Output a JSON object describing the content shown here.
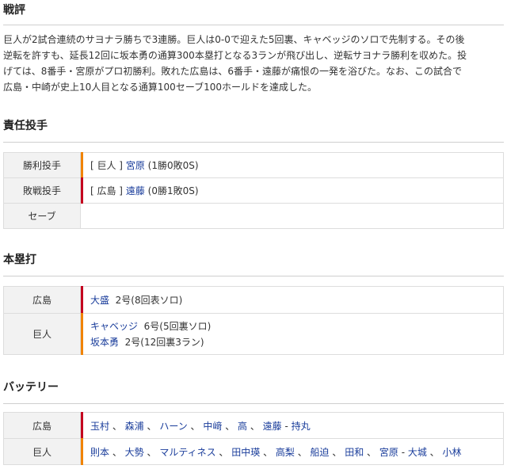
{
  "sections": {
    "review_title": "戦評",
    "pitchers_title": "責任投手",
    "homeruns_title": "本塁打",
    "battery_title": "バッテリー"
  },
  "review": {
    "line1": "巨人が2試合連続のサヨナラ勝ちで3連勝。巨人は0-0で迎えた5回裏、キャベッジのソロで先制する。その後",
    "line2": "逆転を許すも、延長12回に坂本勇の通算300本塁打となる3ランが飛び出し、逆転サヨナラ勝利を収めた。投",
    "line3": "げては、8番手・宮原がプロ初勝利。敗れた広島は、6番手・遠藤が痛恨の一発を浴びた。なお、この試合で",
    "line4": "広島・中崎が史上10人目となる通算100セーブ100ホールドを達成した。"
  },
  "pitchers": {
    "win_label": "勝利投手",
    "win_team": "[ 巨人 ]",
    "win_name": "宮原",
    "win_record": "(1勝0敗0S)",
    "loss_label": "敗戦投手",
    "loss_team": "[ 広島 ]",
    "loss_name": "遠藤",
    "loss_record": "(0勝1敗0S)",
    "save_label": "セーブ"
  },
  "homeruns": {
    "hiroshima_label": "広島",
    "hiroshima": [
      {
        "name": "大盛",
        "detail": "2号(8回表ソロ)"
      }
    ],
    "giants_label": "巨人",
    "giants": [
      {
        "name": "キャベッジ",
        "detail": "6号(5回裏ソロ)"
      },
      {
        "name": "坂本勇",
        "detail": "2号(12回裏3ラン)"
      }
    ]
  },
  "battery": {
    "hiroshima_label": "広島",
    "hiroshima_pitchers": [
      "玉村",
      "森浦",
      "ハーン",
      "中﨑",
      "高",
      "遠藤"
    ],
    "hiroshima_catcher": "持丸",
    "giants_label": "巨人",
    "giants_pitchers": [
      "則本",
      "大勢",
      "マルティネス",
      "田中瑛",
      "高梨",
      "船迫",
      "田和",
      "宮原"
    ],
    "giants_catchers": [
      "大城",
      "小林"
    ],
    "separator": "、",
    "battery_dash": " - "
  },
  "colors": {
    "hiroshima_bar": "#c4001f",
    "giants_bar": "#f08300",
    "link": "#1a3d9b"
  }
}
